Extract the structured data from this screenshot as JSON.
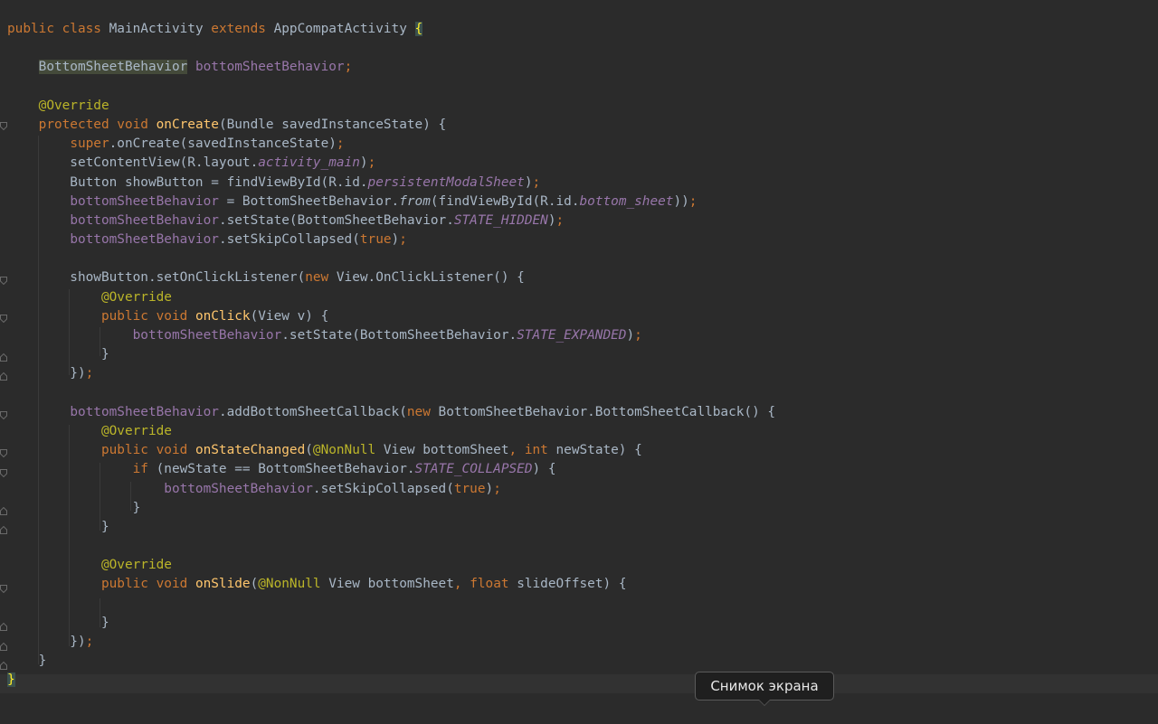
{
  "editor": {
    "tooltip_text": "Снимок экрана",
    "colors": {
      "background": "#2b2b2b",
      "keyword": "#cc7832",
      "field": "#9876aa",
      "annotation": "#bbb529",
      "method": "#ffc66d",
      "text": "#a9b7c6"
    },
    "code_lines": [
      [
        {
          "t": "public class ",
          "c": "keyword"
        },
        {
          "t": "MainActivity ",
          "c": "plain"
        },
        {
          "t": "extends ",
          "c": "keyword"
        },
        {
          "t": "AppCompatActivity ",
          "c": "plain"
        },
        {
          "t": "{",
          "c": "brace-hl"
        }
      ],
      [],
      [
        {
          "t": "    ",
          "c": "plain"
        },
        {
          "t": "BottomSheetBehavior",
          "c": "type-hl"
        },
        {
          "t": " ",
          "c": "plain"
        },
        {
          "t": "bottomSheetBehavior",
          "c": "field"
        },
        {
          "t": ";",
          "c": "keyword"
        }
      ],
      [],
      [
        {
          "t": "    ",
          "c": "plain"
        },
        {
          "t": "@Override",
          "c": "annotation"
        }
      ],
      [
        {
          "t": "    ",
          "c": "plain"
        },
        {
          "t": "protected void ",
          "c": "keyword"
        },
        {
          "t": "onCreate",
          "c": "method"
        },
        {
          "t": "(Bundle savedInstanceState) {",
          "c": "plain"
        }
      ],
      [
        {
          "t": "        ",
          "c": "plain"
        },
        {
          "t": "super",
          "c": "keyword"
        },
        {
          "t": ".onCreate(savedInstanceState)",
          "c": "plain"
        },
        {
          "t": ";",
          "c": "keyword"
        }
      ],
      [
        {
          "t": "        setContentView(R.layout.",
          "c": "plain"
        },
        {
          "t": "activity_main",
          "c": "const"
        },
        {
          "t": ")",
          "c": "plain"
        },
        {
          "t": ";",
          "c": "keyword"
        }
      ],
      [
        {
          "t": "        Button showButton = findViewById(R.id.",
          "c": "plain"
        },
        {
          "t": "persistentModalSheet",
          "c": "const"
        },
        {
          "t": ")",
          "c": "plain"
        },
        {
          "t": ";",
          "c": "keyword"
        }
      ],
      [
        {
          "t": "        ",
          "c": "plain"
        },
        {
          "t": "bottomSheetBehavior",
          "c": "field"
        },
        {
          "t": " = BottomSheetBehavior.",
          "c": "plain"
        },
        {
          "t": "from",
          "c": "static"
        },
        {
          "t": "(findViewById(R.id.",
          "c": "plain"
        },
        {
          "t": "bottom_sheet",
          "c": "const"
        },
        {
          "t": "))",
          "c": "plain"
        },
        {
          "t": ";",
          "c": "keyword"
        }
      ],
      [
        {
          "t": "        ",
          "c": "plain"
        },
        {
          "t": "bottomSheetBehavior",
          "c": "field"
        },
        {
          "t": ".setState(BottomSheetBehavior.",
          "c": "plain"
        },
        {
          "t": "STATE_HIDDEN",
          "c": "const"
        },
        {
          "t": ")",
          "c": "plain"
        },
        {
          "t": ";",
          "c": "keyword"
        }
      ],
      [
        {
          "t": "        ",
          "c": "plain"
        },
        {
          "t": "bottomSheetBehavior",
          "c": "field"
        },
        {
          "t": ".setSkipCollapsed(",
          "c": "plain"
        },
        {
          "t": "true",
          "c": "keyword"
        },
        {
          "t": ")",
          "c": "plain"
        },
        {
          "t": ";",
          "c": "keyword"
        }
      ],
      [],
      [
        {
          "t": "        showButton.setOnClickListener(",
          "c": "plain"
        },
        {
          "t": "new ",
          "c": "keyword"
        },
        {
          "t": "View.OnClickListener() {",
          "c": "plain"
        }
      ],
      [
        {
          "t": "            ",
          "c": "plain"
        },
        {
          "t": "@Override",
          "c": "annotation"
        }
      ],
      [
        {
          "t": "            ",
          "c": "plain"
        },
        {
          "t": "public void ",
          "c": "keyword"
        },
        {
          "t": "onClick",
          "c": "method"
        },
        {
          "t": "(View v) {",
          "c": "plain"
        }
      ],
      [
        {
          "t": "                ",
          "c": "plain"
        },
        {
          "t": "bottomSheetBehavior",
          "c": "field"
        },
        {
          "t": ".setState(BottomSheetBehavior.",
          "c": "plain"
        },
        {
          "t": "STATE_EXPANDED",
          "c": "const"
        },
        {
          "t": ")",
          "c": "plain"
        },
        {
          "t": ";",
          "c": "keyword"
        }
      ],
      [
        {
          "t": "            }",
          "c": "plain"
        }
      ],
      [
        {
          "t": "        })",
          "c": "plain"
        },
        {
          "t": ";",
          "c": "keyword"
        }
      ],
      [],
      [
        {
          "t": "        ",
          "c": "plain"
        },
        {
          "t": "bottomSheetBehavior",
          "c": "field"
        },
        {
          "t": ".addBottomSheetCallback(",
          "c": "plain"
        },
        {
          "t": "new ",
          "c": "keyword"
        },
        {
          "t": "BottomSheetBehavior.BottomSheetCallback() {",
          "c": "plain"
        }
      ],
      [
        {
          "t": "            ",
          "c": "plain"
        },
        {
          "t": "@Override",
          "c": "annotation"
        }
      ],
      [
        {
          "t": "            ",
          "c": "plain"
        },
        {
          "t": "public void ",
          "c": "keyword"
        },
        {
          "t": "onStateChanged",
          "c": "method"
        },
        {
          "t": "(",
          "c": "plain"
        },
        {
          "t": "@NonNull ",
          "c": "annotation"
        },
        {
          "t": "View bottomSheet",
          "c": "plain"
        },
        {
          "t": ", ",
          "c": "keyword"
        },
        {
          "t": "int ",
          "c": "keyword"
        },
        {
          "t": "newState) {",
          "c": "plain"
        }
      ],
      [
        {
          "t": "                ",
          "c": "plain"
        },
        {
          "t": "if ",
          "c": "keyword"
        },
        {
          "t": "(newState == BottomSheetBehavior.",
          "c": "plain"
        },
        {
          "t": "STATE_COLLAPSED",
          "c": "const"
        },
        {
          "t": ") {",
          "c": "plain"
        }
      ],
      [
        {
          "t": "                    ",
          "c": "plain"
        },
        {
          "t": "bottomSheetBehavior",
          "c": "field"
        },
        {
          "t": ".setSkipCollapsed(",
          "c": "plain"
        },
        {
          "t": "true",
          "c": "keyword"
        },
        {
          "t": ")",
          "c": "plain"
        },
        {
          "t": ";",
          "c": "keyword"
        }
      ],
      [
        {
          "t": "                }",
          "c": "plain"
        }
      ],
      [
        {
          "t": "            }",
          "c": "plain"
        }
      ],
      [],
      [
        {
          "t": "            ",
          "c": "plain"
        },
        {
          "t": "@Override",
          "c": "annotation"
        }
      ],
      [
        {
          "t": "            ",
          "c": "plain"
        },
        {
          "t": "public void ",
          "c": "keyword"
        },
        {
          "t": "onSlide",
          "c": "method"
        },
        {
          "t": "(",
          "c": "plain"
        },
        {
          "t": "@NonNull ",
          "c": "annotation"
        },
        {
          "t": "View bottomSheet",
          "c": "plain"
        },
        {
          "t": ", ",
          "c": "keyword"
        },
        {
          "t": "float ",
          "c": "keyword"
        },
        {
          "t": "slideOffset) {",
          "c": "plain"
        }
      ],
      [],
      [
        {
          "t": "            }",
          "c": "plain"
        }
      ],
      [
        {
          "t": "        })",
          "c": "plain"
        },
        {
          "t": ";",
          "c": "keyword"
        }
      ],
      [
        {
          "t": "    }",
          "c": "plain"
        }
      ],
      [
        {
          "t": "}",
          "c": "brace-bottom"
        }
      ]
    ]
  }
}
